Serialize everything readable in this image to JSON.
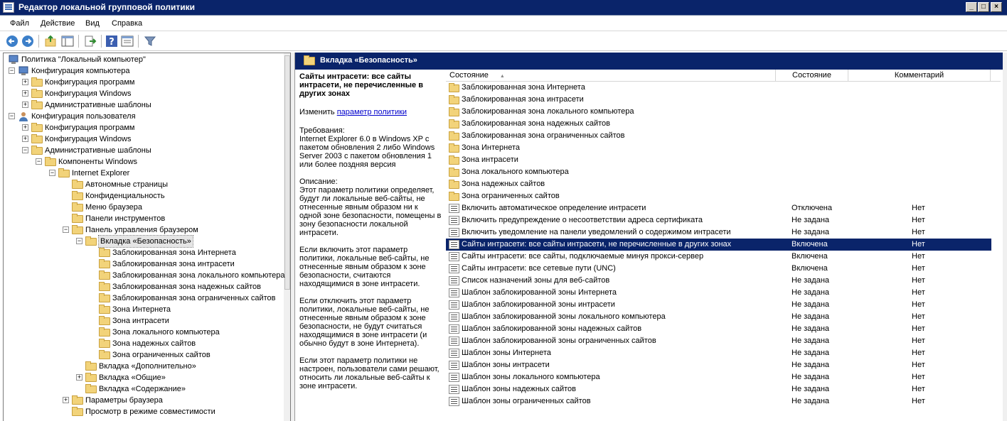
{
  "window": {
    "title": "Редактор локальной групповой политики"
  },
  "menu": [
    "Файл",
    "Действие",
    "Вид",
    "Справка"
  ],
  "toolbar_icons": [
    "back-icon",
    "forward-icon",
    "up-folder-icon",
    "show-hide-tree-icon",
    "export-list-icon",
    "help-icon",
    "properties-icon",
    "filter-icon"
  ],
  "tree": [
    {
      "label": "Политика \"Локальный компьютер\"",
      "depth": 0,
      "expander": "",
      "icon": "computer-policy-icon"
    },
    {
      "label": "Конфигурация компьютера",
      "depth": 0,
      "expander": "−",
      "icon": "computer-icon"
    },
    {
      "label": "Конфигурация программ",
      "depth": 1,
      "expander": "+",
      "icon": "folder-icon"
    },
    {
      "label": "Конфигурация Windows",
      "depth": 1,
      "expander": "+",
      "icon": "folder-icon"
    },
    {
      "label": "Административные шаблоны",
      "depth": 1,
      "expander": "+",
      "icon": "folder-icon"
    },
    {
      "label": "Конфигурация пользователя",
      "depth": 0,
      "expander": "−",
      "icon": "user-icon"
    },
    {
      "label": "Конфигурация программ",
      "depth": 1,
      "expander": "+",
      "icon": "folder-icon"
    },
    {
      "label": "Конфигурация Windows",
      "depth": 1,
      "expander": "+",
      "icon": "folder-icon"
    },
    {
      "label": "Административные шаблоны",
      "depth": 1,
      "expander": "−",
      "icon": "folder-icon"
    },
    {
      "label": "Компоненты Windows",
      "depth": 2,
      "expander": "−",
      "icon": "folder-icon"
    },
    {
      "label": "Internet Explorer",
      "depth": 3,
      "expander": "−",
      "icon": "folder-icon"
    },
    {
      "label": "Автономные страницы",
      "depth": 4,
      "expander": "",
      "icon": "folder-icon"
    },
    {
      "label": "Конфиденциальность",
      "depth": 4,
      "expander": "",
      "icon": "folder-icon"
    },
    {
      "label": "Меню браузера",
      "depth": 4,
      "expander": "",
      "icon": "folder-icon"
    },
    {
      "label": "Панели инструментов",
      "depth": 4,
      "expander": "",
      "icon": "folder-icon"
    },
    {
      "label": "Панель управления браузером",
      "depth": 4,
      "expander": "−",
      "icon": "folder-icon"
    },
    {
      "label": "Вкладка «Безопасность»",
      "depth": 5,
      "expander": "−",
      "icon": "folder-icon",
      "selected": true
    },
    {
      "label": "Заблокированная зона Интернета",
      "depth": 6,
      "expander": "",
      "icon": "folder-icon"
    },
    {
      "label": "Заблокированная зона интрасети",
      "depth": 6,
      "expander": "",
      "icon": "folder-icon"
    },
    {
      "label": "Заблокированная зона локального компьютера",
      "depth": 6,
      "expander": "",
      "icon": "folder-icon"
    },
    {
      "label": "Заблокированная зона надежных сайтов",
      "depth": 6,
      "expander": "",
      "icon": "folder-icon"
    },
    {
      "label": "Заблокированная зона ограниченных сайтов",
      "depth": 6,
      "expander": "",
      "icon": "folder-icon"
    },
    {
      "label": "Зона Интернета",
      "depth": 6,
      "expander": "",
      "icon": "folder-icon"
    },
    {
      "label": "Зона интрасети",
      "depth": 6,
      "expander": "",
      "icon": "folder-icon"
    },
    {
      "label": "Зона локального компьютера",
      "depth": 6,
      "expander": "",
      "icon": "folder-icon"
    },
    {
      "label": "Зона надежных сайтов",
      "depth": 6,
      "expander": "",
      "icon": "folder-icon"
    },
    {
      "label": "Зона ограниченных сайтов",
      "depth": 6,
      "expander": "",
      "icon": "folder-icon"
    },
    {
      "label": "Вкладка «Дополнительно»",
      "depth": 5,
      "expander": "",
      "icon": "folder-icon"
    },
    {
      "label": "Вкладка «Общие»",
      "depth": 5,
      "expander": "+",
      "icon": "folder-icon"
    },
    {
      "label": "Вкладка «Содержание»",
      "depth": 5,
      "expander": "",
      "icon": "folder-icon"
    },
    {
      "label": "Параметры браузера",
      "depth": 4,
      "expander": "+",
      "icon": "folder-icon"
    },
    {
      "label": "Просмотр в режиме совместимости",
      "depth": 4,
      "expander": "",
      "icon": "folder-icon"
    }
  ],
  "pane_header": "Вкладка «Безопасность»",
  "description": {
    "title": "Сайты интрасети: все сайты интрасети, не перечисленные в других зонах",
    "edit_prefix": "Изменить ",
    "edit_link": "параметр политики",
    "paragraphs": [
      "Требования:\nInternet Explorer 6.0 в Windows XP с пакетом обновления 2 либо Windows Server 2003 с пакетом обновления 1 или более поздняя версия",
      "Описание:\nЭтот параметр политики определяет, будут ли локальные веб-сайты, не отнесенные явным образом ни к одной зоне безопасности, помещены в зону безопасности локальной интрасети.",
      "Если включить этот параметр политики, локальные веб-сайты, не отнесенные явным образом к зоне безопасности, считаются находящимися в зоне интрасети.",
      "Если отключить этот параметр политики, локальные веб-сайты, не отнесенные явным образом к зоне безопасности, не будут считаться находящимися в зоне интрасети (и обычно будут в зоне Интернета).",
      "Если этот параметр политики не настроен, пользователи сами решают, относить ли локальные веб-сайты к зоне интрасети."
    ]
  },
  "columns": {
    "name": "Состояние",
    "sort_glyph": "▲",
    "state": "Состояние",
    "comment": "Комментарий"
  },
  "rows": [
    {
      "name": "Заблокированная зона Интернета",
      "icon": "folder-icon",
      "state": "",
      "comment": ""
    },
    {
      "name": "Заблокированная зона интрасети",
      "icon": "folder-icon",
      "state": "",
      "comment": ""
    },
    {
      "name": "Заблокированная зона локального компьютера",
      "icon": "folder-icon",
      "state": "",
      "comment": ""
    },
    {
      "name": "Заблокированная зона надежных сайтов",
      "icon": "folder-icon",
      "state": "",
      "comment": ""
    },
    {
      "name": "Заблокированная зона ограниченных сайтов",
      "icon": "folder-icon",
      "state": "",
      "comment": ""
    },
    {
      "name": "Зона Интернета",
      "icon": "folder-icon",
      "state": "",
      "comment": ""
    },
    {
      "name": "Зона интрасети",
      "icon": "folder-icon",
      "state": "",
      "comment": ""
    },
    {
      "name": "Зона локального компьютера",
      "icon": "folder-icon",
      "state": "",
      "comment": ""
    },
    {
      "name": "Зона надежных сайтов",
      "icon": "folder-icon",
      "state": "",
      "comment": ""
    },
    {
      "name": "Зона ограниченных сайтов",
      "icon": "folder-icon",
      "state": "",
      "comment": ""
    },
    {
      "name": "Включить автоматическое определение интрасети",
      "icon": "policy-setting-icon",
      "state": "Отключена",
      "comment": "Нет"
    },
    {
      "name": "Включить предупреждение о несоответствии адреса сертификата",
      "icon": "policy-setting-icon",
      "state": "Не задана",
      "comment": "Нет"
    },
    {
      "name": "Включить уведомление на панели уведомлений о содержимом интрасети",
      "icon": "policy-setting-icon",
      "state": "Не задана",
      "comment": "Нет"
    },
    {
      "name": "Сайты интрасети: все сайты интрасети, не перечисленные в других зонах",
      "icon": "policy-setting-icon",
      "state": "Включена",
      "comment": "Нет",
      "selected": true
    },
    {
      "name": "Сайты интрасети: все сайты, подключаемые минуя прокси-сервер",
      "icon": "policy-setting-icon",
      "state": "Включена",
      "comment": "Нет"
    },
    {
      "name": "Сайты интрасети: все сетевые пути (UNC)",
      "icon": "policy-setting-icon",
      "state": "Включена",
      "comment": "Нет"
    },
    {
      "name": "Список назначений зоны для веб-сайтов",
      "icon": "policy-setting-icon",
      "state": "Не задана",
      "comment": "Нет"
    },
    {
      "name": "Шаблон заблокированной зоны Интернета",
      "icon": "policy-setting-icon",
      "state": "Не задана",
      "comment": "Нет"
    },
    {
      "name": "Шаблон заблокированной зоны интрасети",
      "icon": "policy-setting-icon",
      "state": "Не задана",
      "comment": "Нет"
    },
    {
      "name": "Шаблон заблокированной зоны локального компьютера",
      "icon": "policy-setting-icon",
      "state": "Не задана",
      "comment": "Нет"
    },
    {
      "name": "Шаблон заблокированной зоны надежных сайтов",
      "icon": "policy-setting-icon",
      "state": "Не задана",
      "comment": "Нет"
    },
    {
      "name": "Шаблон заблокированной зоны ограниченных сайтов",
      "icon": "policy-setting-icon",
      "state": "Не задана",
      "comment": "Нет"
    },
    {
      "name": "Шаблон зоны Интернета",
      "icon": "policy-setting-icon",
      "state": "Не задана",
      "comment": "Нет"
    },
    {
      "name": "Шаблон зоны интрасети",
      "icon": "policy-setting-icon",
      "state": "Не задана",
      "comment": "Нет"
    },
    {
      "name": "Шаблон зоны локального компьютера",
      "icon": "policy-setting-icon",
      "state": "Не задана",
      "comment": "Нет"
    },
    {
      "name": "Шаблон зоны надежных сайтов",
      "icon": "policy-setting-icon",
      "state": "Не задана",
      "comment": "Нет"
    },
    {
      "name": "Шаблон зоны ограниченных сайтов",
      "icon": "policy-setting-icon",
      "state": "Не задана",
      "comment": "Нет"
    }
  ],
  "colors": {
    "title_bar": "#0a246a",
    "selection": "#0a246a",
    "folder": "#f2d37a",
    "link": "#0000cc"
  }
}
